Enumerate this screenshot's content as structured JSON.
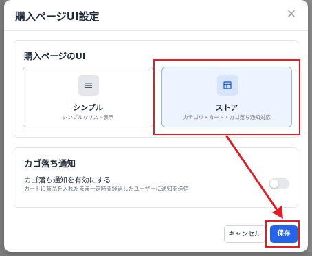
{
  "dialog": {
    "title": "購入ページUI設定",
    "close_icon": "close-icon",
    "close_symbol": "✕"
  },
  "ui_section": {
    "heading": "購入ページのUI",
    "options": [
      {
        "title": "シンプル",
        "subtitle": "シンプルなリスト表示",
        "icon": "list-icon",
        "selected": false
      },
      {
        "title": "ストア",
        "subtitle": "カテゴリ・カート・カゴ落ち通知対応",
        "icon": "store-layout-icon",
        "selected": true
      }
    ]
  },
  "cart_section": {
    "heading": "カゴ落ち通知",
    "toggle_label": "カゴ落ち通知を有効にする",
    "toggle_description": "カートに商品を入れたまま一定時間経過したユーザーに通知を送信",
    "toggle_enabled": false
  },
  "footer": {
    "cancel_label": "キャンセル",
    "save_label": "保存"
  },
  "colors": {
    "accent": "#2563eb",
    "annotation": "#e11d26",
    "selected_card_bg": "#eef4ff"
  }
}
